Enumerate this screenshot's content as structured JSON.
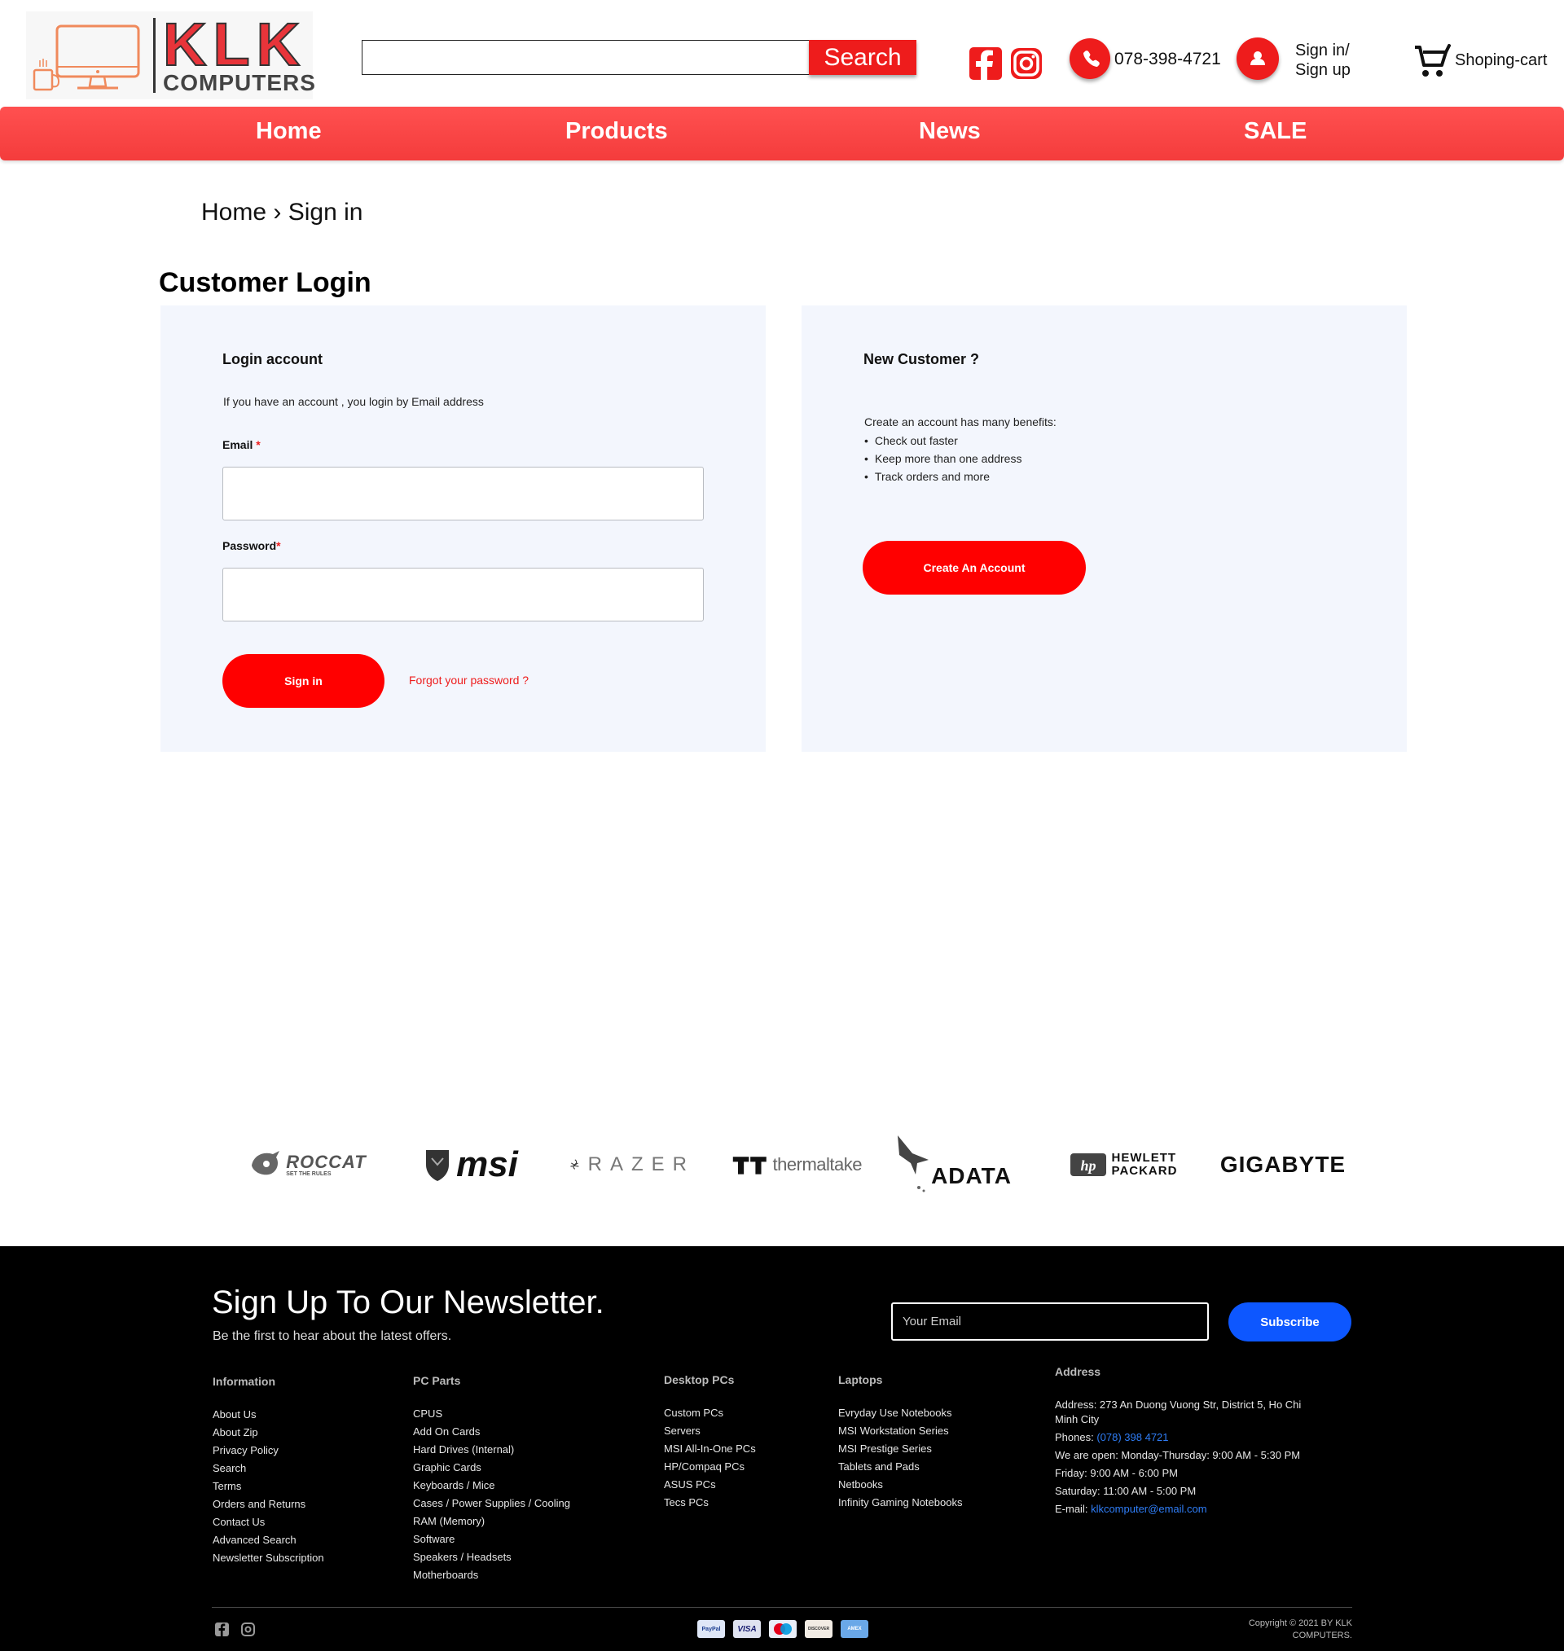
{
  "header": {
    "logo_title": "KLK",
    "logo_subtitle": "COMPUTERS",
    "search_placeholder": "",
    "search_button": "Search",
    "phone": "078-398-4721",
    "signin_line1": "Sign in/",
    "signin_line2": "Sign up",
    "cart_label": "Shoping-cart"
  },
  "nav": {
    "items": [
      {
        "label": "Home"
      },
      {
        "label": "Products"
      },
      {
        "label": "News"
      },
      {
        "label": "SALE"
      }
    ]
  },
  "breadcrumb": {
    "home": "Home",
    "separator": "›",
    "current": "Sign in"
  },
  "page_title": "Customer Login",
  "login_panel": {
    "heading": "Login account",
    "description": "If you have an account , you login by Email address",
    "email_label": "Email",
    "email_value": "",
    "password_label": "Password",
    "password_value": "",
    "required_mark": "*",
    "signin_button": "Sign in",
    "forgot_link": "Forgot your password ?"
  },
  "new_customer_panel": {
    "heading": "New Customer ?",
    "intro": "Create an account has many benefits:",
    "benefits": [
      "Check out faster",
      "Keep more than one address",
      "Track orders and more"
    ],
    "create_button": "Create An Account"
  },
  "brands": [
    "ROCCAT",
    "SET THE RULES",
    "msi",
    "RAZER",
    "thermaltake",
    "ADATA",
    "HEWLETT",
    "PACKARD",
    "GIGABYTE"
  ],
  "footer": {
    "newsletter_title": "Sign Up To Our Newsletter.",
    "newsletter_subtitle": "Be the first to hear about the latest offers.",
    "email_placeholder": "Your Email",
    "subscribe_button": "Subscribe",
    "columns": [
      {
        "heading": "Information",
        "links": [
          "About Us",
          "About Zip",
          "Privacy Policy",
          "Search",
          "Terms",
          "Orders and Returns",
          "Contact Us",
          "Advanced Search",
          "Newsletter Subscription"
        ]
      },
      {
        "heading": "PC Parts",
        "links": [
          "CPUS",
          "Add On Cards",
          "Hard Drives (Internal)",
          "Graphic Cards",
          "Keyboards / Mice",
          "Cases / Power Supplies / Cooling",
          "RAM (Memory)",
          "Software",
          "Speakers / Headsets",
          "Motherboards"
        ]
      },
      {
        "heading": "Desktop PCs",
        "links": [
          "Custom PCs",
          "Servers",
          "MSI All-In-One PCs",
          "HP/Compaq PCs",
          "ASUS PCs",
          "Tecs PCs"
        ]
      },
      {
        "heading": "Laptops",
        "links": [
          "Evryday Use Notebooks",
          "MSI Workstation Series",
          "MSI Prestige Series",
          "Tablets and Pads",
          "Netbooks",
          "Infinity Gaming Notebooks"
        ]
      }
    ],
    "address": {
      "heading": "Address",
      "line_address": "Address: 273 An Duong Vuong Str, District 5, Ho Chi Minh City",
      "phones_label": "Phones: ",
      "phones_value": "(078) 398 4721",
      "hours_weekday": "We are open: Monday-Thursday: 9:00 AM - 5:30 PM",
      "hours_friday": "Friday: 9:00 AM - 6:00 PM",
      "hours_saturday": "Saturday: 11:00 AM - 5:00 PM",
      "email_label": "E-mail: ",
      "email_value": "klkcomputer@email.com"
    },
    "payment_methods": [
      "PayPal",
      "VISA",
      "maestro",
      "DISCOVER",
      "AMEX"
    ],
    "copyright_line1": "Copyright © 2021 BY KLK",
    "copyright_line2": "COMPUTERS."
  },
  "colors": {
    "brand_red": "#ee1c1c",
    "panel_bg": "#f3f6fd",
    "footer_bg": "#000000",
    "subscribe_blue": "#0d57ff",
    "link_blue": "#2f7df6"
  },
  "icons": [
    "facebook-icon",
    "instagram-icon",
    "phone-icon",
    "user-icon",
    "cart-icon",
    "computer-logo-icon"
  ]
}
